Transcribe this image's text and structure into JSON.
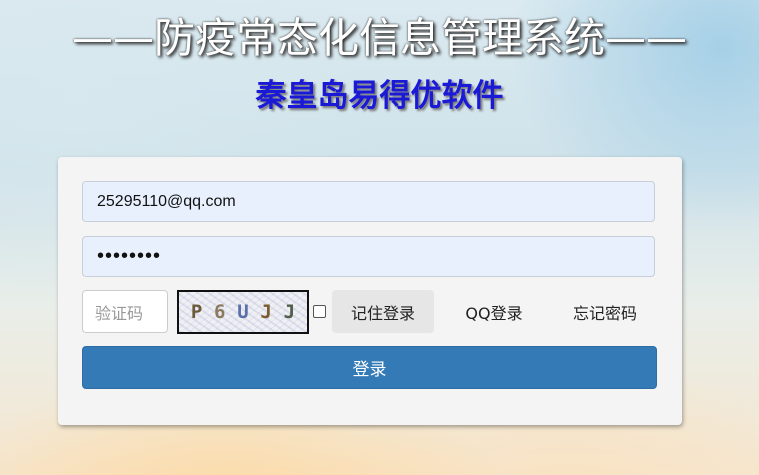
{
  "header": {
    "title": "——防疫常态化信息管理系统——",
    "subtitle": "秦皇岛易得优软件"
  },
  "form": {
    "email_value": "25295110@qq.com",
    "password_value": "••••••••",
    "captcha_placeholder": "验证码",
    "captcha_chars": [
      {
        "char": "P",
        "color": "#6b5a3a"
      },
      {
        "char": "6",
        "color": "#8a7a5e"
      },
      {
        "char": "U",
        "color": "#5b6fa8"
      },
      {
        "char": "J",
        "color": "#7a5c30"
      },
      {
        "char": "J",
        "color": "#4f5f4a"
      }
    ],
    "remember_checked": false,
    "remember_label": "记住登录",
    "qq_login_label": "QQ登录",
    "forgot_label": "忘记密码",
    "login_label": "登录"
  },
  "colors": {
    "title_text": "#ffffff",
    "subtitle_text": "#1a1ad6",
    "login_button": "#337ab7",
    "input_fill": "#e8f0fe"
  }
}
